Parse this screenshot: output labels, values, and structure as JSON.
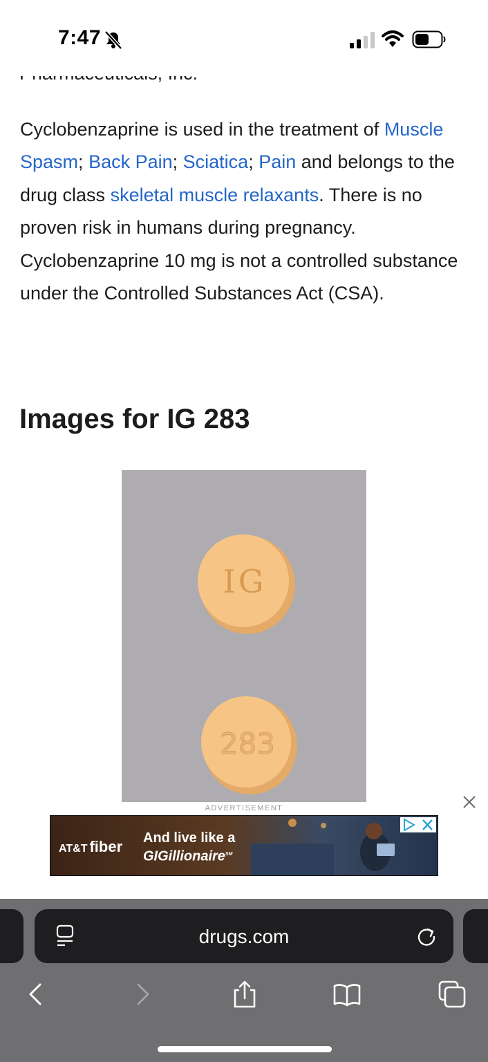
{
  "status_bar": {
    "time": "7:47"
  },
  "article": {
    "cut_off_line": "Pharmaceuticals, Inc.",
    "p_1": "Cyclobenzaprine is used in the treatment of",
    "link_muscle_spasm": "Muscle Spasm",
    "sep_1": "; ",
    "link_back_pain": "Back Pain",
    "sep_2": "; ",
    "link_sciatica": "Sciatica",
    "sep_3": "; ",
    "link_pain": "Pain",
    "p_2": " and belongs to the drug class ",
    "link_drug_class": "skeletal muscle relaxants",
    "p_3": ". There is no proven risk in humans during pregnancy. Cyclobenzaprine 10 mg is not a controlled substance under the Controlled Substances Act (CSA).",
    "images_heading": "Images for IG 283"
  },
  "pill_image": {
    "imprint_top": "IG",
    "imprint_bottom": "283",
    "pill_color": "#f6c585",
    "background_color": "#a9a8ac"
  },
  "ad": {
    "label": "ADVERTISEMENT",
    "brand_prefix": "AT&T",
    "brand_main": "fiber",
    "headline_line1": "And live like a",
    "headline_line2": "GIGillionaire",
    "trademark": "SM"
  },
  "browser": {
    "url": "drugs.com"
  },
  "icons": {
    "bell": "bell-slash-icon",
    "signal": "cellular-signal-icon",
    "wifi": "wifi-icon",
    "battery": "battery-icon",
    "page_menu": "page-menu-icon",
    "reload": "reload-icon",
    "back": "chevron-left-icon",
    "forward": "chevron-right-icon",
    "share": "share-icon",
    "bookmarks": "book-icon",
    "tabs": "tabs-icon",
    "close": "close-icon",
    "ad_choices": "ad-choices-icon"
  },
  "colors": {
    "link": "#2466c8",
    "text": "#1c1c1e",
    "chrome": "#6f6f71",
    "address_bar": "#1e1e20"
  }
}
